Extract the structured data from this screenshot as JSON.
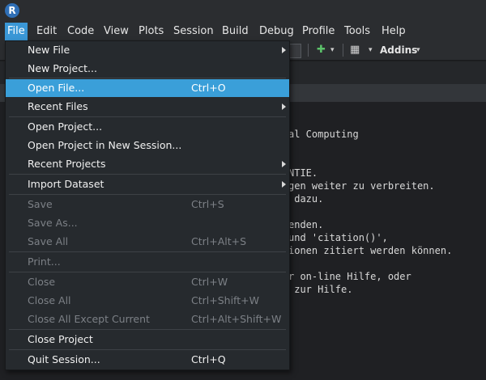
{
  "menubar": {
    "items": [
      "File",
      "Edit",
      "Code",
      "View",
      "Plots",
      "Session",
      "Build",
      "Debug",
      "Profile",
      "Tools",
      "Help"
    ],
    "active": "File"
  },
  "toolbar": {
    "addins_label": "Addins"
  },
  "console_lines": [
    "al Computing",
    "NTIE.",
    "gen weiter zu verbreiten.",
    " dazu.",
    "enden.",
    "und 'citation()',",
    "ionen zitiert werden können.",
    "r on-line Hilfe, oder",
    " zur Hilfe."
  ],
  "file_menu": {
    "new_file": "New File",
    "new_project": "New Project...",
    "open_file": "Open File...",
    "open_file_shortcut": "Ctrl+O",
    "recent_files": "Recent Files",
    "open_project": "Open Project...",
    "open_project_new_session": "Open Project in New Session...",
    "recent_projects": "Recent Projects",
    "import_dataset": "Import Dataset",
    "save": "Save",
    "save_shortcut": "Ctrl+S",
    "save_as": "Save As...",
    "save_all": "Save All",
    "save_all_shortcut": "Ctrl+Alt+S",
    "print": "Print...",
    "close": "Close",
    "close_shortcut": "Ctrl+W",
    "close_all": "Close All",
    "close_all_shortcut": "Ctrl+Shift+W",
    "close_all_except": "Close All Except Current",
    "close_all_except_shortcut": "Ctrl+Alt+Shift+W",
    "close_project": "Close Project",
    "quit_session": "Quit Session...",
    "quit_shortcut": "Ctrl+Q"
  },
  "colors": {
    "highlight": "#3a9fd9",
    "menu_bg": "#262a2e",
    "disabled_text": "#7c8086"
  }
}
